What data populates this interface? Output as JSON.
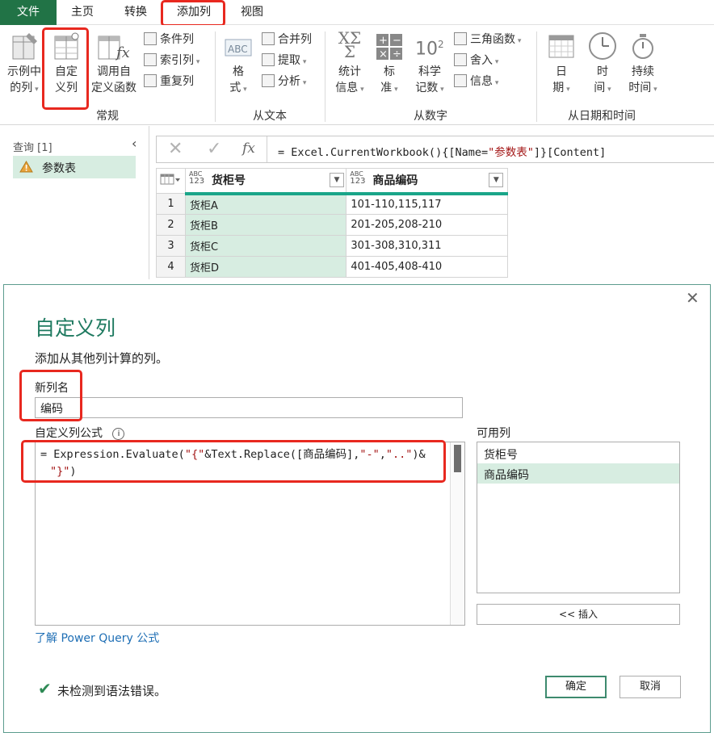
{
  "menu": {
    "file": "文件",
    "home": "主页",
    "transform": "转换",
    "add_column": "添加列",
    "view": "视图"
  },
  "ribbon": {
    "general": {
      "label": "常规",
      "example_column": [
        "示例中",
        "的列"
      ],
      "custom_column": [
        "自定",
        "义列"
      ],
      "invoke_custom_function": [
        "调用自",
        "定义函数"
      ],
      "conditional_column": "条件列",
      "index_column": "索引列",
      "duplicate_column": "重复列"
    },
    "from_text": {
      "label": "从文本",
      "format": [
        "格",
        "式"
      ],
      "merge_columns": "合并列",
      "extract": "提取",
      "parse": "分析"
    },
    "from_number": {
      "label": "从数字",
      "statistics": [
        "统计",
        "信息"
      ],
      "standard": [
        "标",
        "准"
      ],
      "scientific": [
        "科学",
        "记数"
      ],
      "trigonometry": "三角函数",
      "rounding": "舍入",
      "information": "信息"
    },
    "from_datetime": {
      "label": "从日期和时间",
      "date": [
        "日",
        "期"
      ],
      "time": [
        "时",
        "间"
      ],
      "duration": [
        "持续",
        "时间"
      ]
    }
  },
  "queries": {
    "title": "查询 [1]",
    "items": [
      {
        "name": "参数表",
        "warning": true
      }
    ]
  },
  "formula_bar": {
    "fx": "fx",
    "formula_prefix": "= Excel.CurrentWorkbook(){[Name=",
    "formula_string": "\"参数表\"",
    "formula_suffix": "]}[Content]"
  },
  "table": {
    "type_badge": [
      "ABC",
      "123"
    ],
    "columns": [
      "货柜号",
      "商品编码"
    ],
    "rows": [
      {
        "n": "1",
        "c1": "货柜A",
        "c2": "101-110,115,117"
      },
      {
        "n": "2",
        "c1": "货柜B",
        "c2": "201-205,208-210"
      },
      {
        "n": "3",
        "c1": "货柜C",
        "c2": "301-308,310,311"
      },
      {
        "n": "4",
        "c1": "货柜D",
        "c2": "401-405,408-410"
      }
    ]
  },
  "dialog": {
    "title": "自定义列",
    "subtitle": "添加从其他列计算的列。",
    "new_column_label": "新列名",
    "new_column_value": "编码",
    "formula_label": "自定义列公式",
    "formula_line1_a": "= Expression.Evaluate(",
    "formula_line1_b": "\"{\"",
    "formula_line1_c": "&Text.Replace([商品编码],",
    "formula_line1_d": "\"-\"",
    "formula_line1_e": ",",
    "formula_line1_f": "\"..\"",
    "formula_line1_g": ")&",
    "formula_line2_a": "\"}\"",
    "formula_line2_b": ")",
    "available_label": "可用列",
    "available_columns": [
      "货柜号",
      "商品编码"
    ],
    "insert_button": "<< 插入",
    "learn_link": "了解 Power Query 公式",
    "status": "未检测到语法错误。",
    "ok_button": "确定",
    "cancel_button": "取消"
  },
  "colors": {
    "excel_green": "#217346",
    "annotation_red": "#e8281f",
    "selected_fill": "#d7ede1",
    "accent_teal": "#1aa589",
    "formula_string": "#a31515"
  }
}
